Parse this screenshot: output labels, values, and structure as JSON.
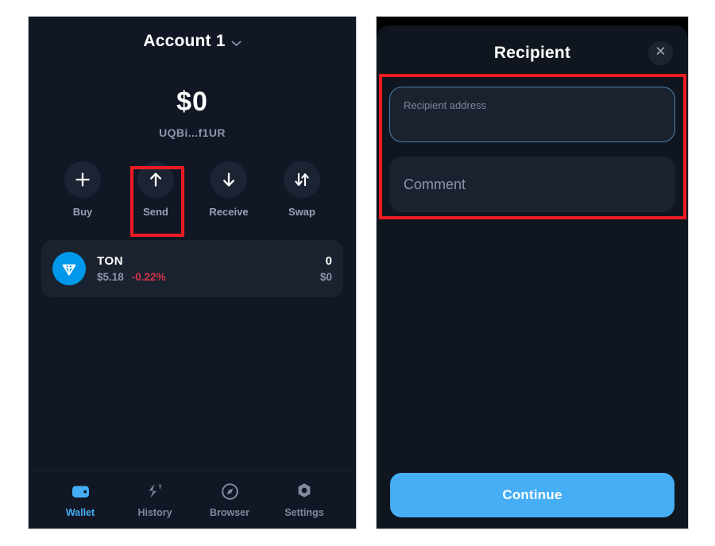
{
  "theme": {
    "bg": "#ffffff",
    "panel_bg": "#111724",
    "sheet_bg": "#10161F",
    "card_bg": "#1a2230",
    "accent_blue": "#45AEF5",
    "ton_blue": "#0098EA",
    "muted_text": "#8c96a8",
    "negative_red": "#d2364b",
    "highlight_red": "#ED1B24"
  },
  "wallet_screen": {
    "account": {
      "name": "Account 1",
      "dropdown_icon": "chevron-down-icon"
    },
    "balance": {
      "total": "$0",
      "address": "UQBi...f1UR"
    },
    "actions": [
      {
        "label": "Buy",
        "icon": "plus-icon",
        "highlighted": false
      },
      {
        "label": "Send",
        "icon": "arrow-up-icon",
        "highlighted": true
      },
      {
        "label": "Receive",
        "icon": "arrow-down-icon",
        "highlighted": false
      },
      {
        "label": "Swap",
        "icon": "swap-arrows-icon",
        "highlighted": false
      }
    ],
    "tokens": [
      {
        "symbol": "TON",
        "logo_icon": "ton-logo-icon",
        "price": "$5.18",
        "change": "-0.22%",
        "change_negative": true,
        "amount": "0",
        "value": "$0"
      }
    ],
    "bottom_nav": [
      {
        "label": "Wallet",
        "icon": "wallet-icon",
        "active": true
      },
      {
        "label": "History",
        "icon": "history-icon",
        "active": false
      },
      {
        "label": "Browser",
        "icon": "browser-icon",
        "active": false
      },
      {
        "label": "Settings",
        "icon": "settings-icon",
        "active": false
      }
    ]
  },
  "recipient_screen": {
    "title": "Recipient",
    "close_icon": "close-icon",
    "recipient_field": {
      "placeholder": "Recipient address",
      "value": "",
      "focused": true
    },
    "comment_field": {
      "placeholder": "Comment",
      "value": "",
      "focused": false
    },
    "continue_label": "Continue"
  }
}
